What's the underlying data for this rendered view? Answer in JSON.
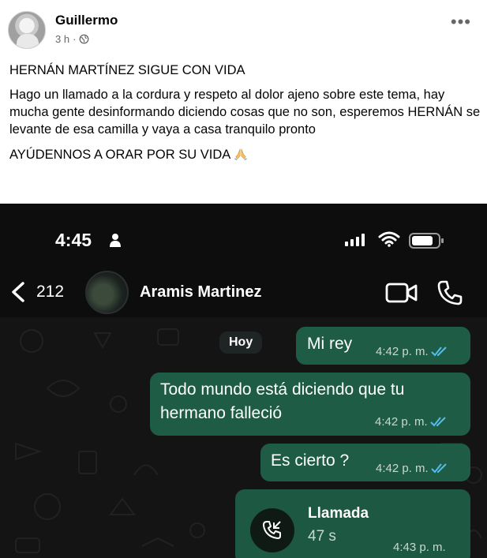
{
  "post": {
    "author": "Guillermo",
    "time": "3 h",
    "separator": "·",
    "more_label": "•••",
    "paragraphs": [
      "HERNÁN MARTÍNEZ SIGUE CON VIDA",
      "Hago un llamado a la cordura y respeto al dolor ajeno sobre este tema, hay mucha gente desinformando diciendo cosas que no son, esperemos HERNÁN se levante de esa camilla y vaya a casa tranquilo pronto",
      "AYÚDENNOS A ORAR POR SU VIDA"
    ],
    "emoji": "praying-hands-icon"
  },
  "phone": {
    "status_time": "4:45",
    "back_count": "212",
    "contact_name": "Aramis Martinez",
    "day_label": "Hoy",
    "messages": [
      {
        "text": "Mi rey",
        "time": "4:42 p. m."
      },
      {
        "text": "Todo mundo está diciendo que tu hermano falleció",
        "time": "4:42 p. m."
      },
      {
        "text": "Es cierto ?",
        "time": "4:42 p. m."
      }
    ],
    "call": {
      "title": "Llamada",
      "duration": "47 s",
      "time": "4:43 p. m."
    },
    "colors": {
      "bubble": "#1f5c45",
      "background": "#141414",
      "tick_blue": "#53bdeb"
    }
  }
}
